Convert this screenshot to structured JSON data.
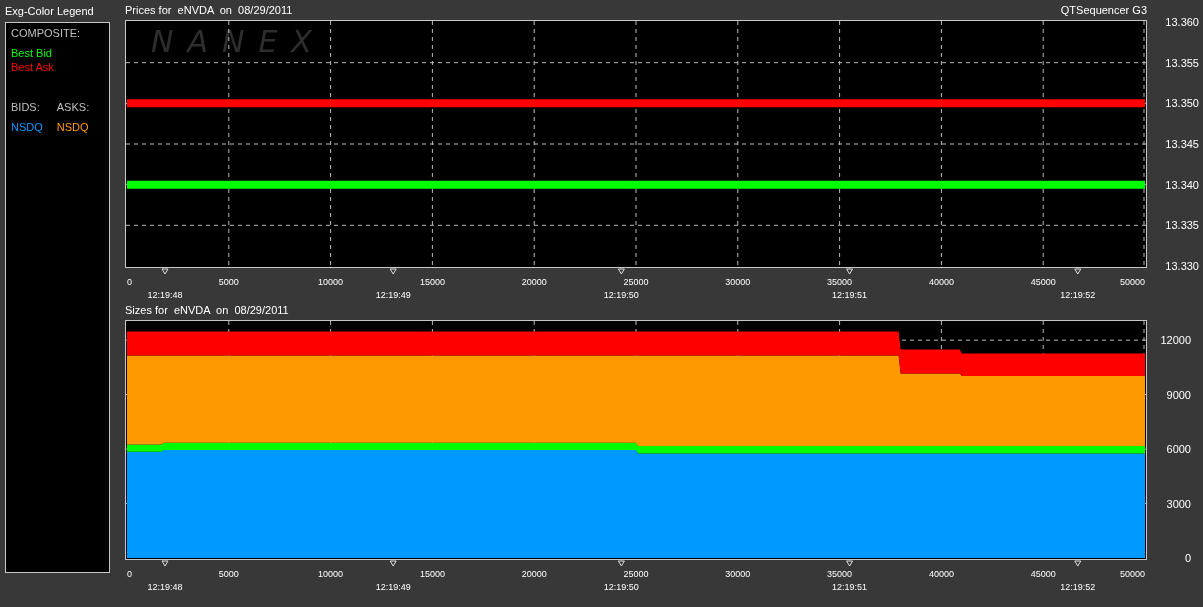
{
  "legend": {
    "title": "Exg-Color Legend",
    "composite_label": "COMPOSITE:",
    "composite_items": [
      {
        "label": "Best Bid",
        "color": "#00ff00"
      },
      {
        "label": "Best Ask",
        "color": "#ff0000"
      }
    ],
    "bids_label": "BIDS:",
    "asks_label": "ASKS:",
    "bid_exchanges": [
      {
        "label": "NSDQ",
        "color": "#0099ff"
      }
    ],
    "ask_exchanges": [
      {
        "label": "NSDQ",
        "color": "#ff9900"
      }
    ]
  },
  "price_panel": {
    "title": "Prices for  eNVDA  on  08/29/2011",
    "app_name": "QTSequencer G3",
    "logo": "NANEX",
    "chart_data": {
      "type": "line",
      "x": [
        0,
        50000
      ],
      "series": [
        {
          "color": "#ff0000",
          "values": [
            13.35,
            13.35
          ]
        },
        {
          "color": "#00ff00",
          "values": [
            13.34,
            13.34
          ]
        }
      ],
      "grid": true,
      "xlim": [
        0,
        50000
      ],
      "ylim": [
        13.33,
        13.36
      ],
      "xticks": [
        0,
        5000,
        10000,
        15000,
        20000,
        25000,
        30000,
        35000,
        40000,
        45000,
        50000
      ],
      "yticks": [
        {
          "value": 13.33,
          "label": "13.330"
        },
        {
          "value": 13.335,
          "label": "13.335"
        },
        {
          "value": 13.34,
          "label": "13.340"
        },
        {
          "value": 13.345,
          "label": "13.345"
        },
        {
          "value": 13.35,
          "label": "13.350"
        },
        {
          "value": 13.355,
          "label": "13.355"
        },
        {
          "value": 13.36,
          "label": "13.360"
        }
      ]
    },
    "time_marks": [
      "12:19:48",
      "12:19:49",
      "12:19:50",
      "12:19:51",
      "12:19:52"
    ]
  },
  "size_panel": {
    "title": "Sizes for  eNVDA  on  08/29/2011",
    "chart_data": {
      "type": "area",
      "stacked": true,
      "x": [
        0,
        1700,
        1800,
        25000,
        25100,
        37900,
        38000,
        40900,
        41000,
        50000
      ],
      "series": [
        {
          "color": "#0099ff",
          "values": [
            5850,
            5850,
            5950,
            5950,
            5750,
            5750,
            5750,
            5750,
            5750,
            5750
          ]
        },
        {
          "color": "#00ff00",
          "values": [
            400,
            400,
            400,
            400,
            420,
            420,
            420,
            420,
            420,
            420
          ]
        },
        {
          "color": "#ff9900",
          "values": [
            4900,
            4900,
            4800,
            4800,
            4980,
            4980,
            4000,
            4000,
            3850,
            3850
          ]
        },
        {
          "color": "#ff0000",
          "values": [
            1320,
            1320,
            1320,
            1320,
            1320,
            1320,
            1310,
            1310,
            1250,
            1250
          ]
        }
      ],
      "grid": true,
      "xlim": [
        0,
        50000
      ],
      "ylim": [
        0,
        13000
      ],
      "xticks": [
        0,
        5000,
        10000,
        15000,
        20000,
        25000,
        30000,
        35000,
        40000,
        45000,
        50000
      ],
      "yticks": [
        0,
        3000,
        6000,
        9000,
        12000
      ]
    },
    "time_marks": [
      "12:19:48",
      "12:19:49",
      "12:19:50",
      "12:19:51",
      "12:19:52"
    ]
  }
}
